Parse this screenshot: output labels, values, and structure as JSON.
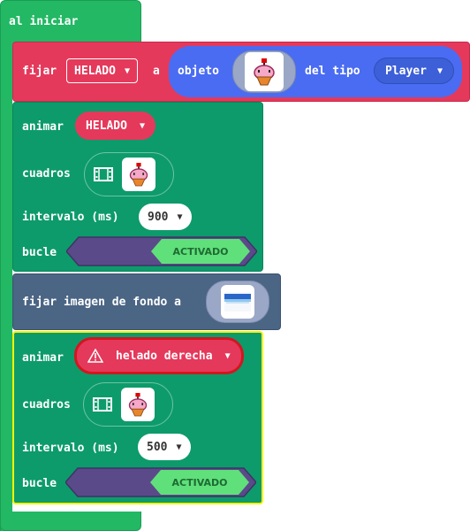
{
  "on_start": {
    "label": "al iniciar"
  },
  "set_sprite": {
    "set_label": "fijar",
    "variable": "HELADO",
    "to_label": "a",
    "sprite_label": "objeto",
    "kind_label": "del tipo",
    "kind_value": "Player"
  },
  "animate_1": {
    "animate_label": "animar",
    "target": "HELADO",
    "frames_label": "cuadros",
    "interval_label": "intervalo (ms)",
    "interval_value": "900",
    "loop_label": "bucle",
    "loop_state": "ACTIVADO"
  },
  "background": {
    "label": "fijar imagen de fondo a"
  },
  "animate_2": {
    "animate_label": "animar",
    "target": "helado derecha",
    "frames_label": "cuadros",
    "interval_label": "intervalo (ms)",
    "interval_value": "500",
    "loop_label": "bucle",
    "loop_state": "ACTIVADO"
  },
  "colors": {
    "event_green": "#22b864",
    "sprite_red": "#e5395b",
    "animation_green": "#0d9b6b",
    "scene_slate": "#4b6584",
    "sprite_kind_blue": "#4a6cf2",
    "toggle_purple": "#5b4a8a",
    "toggle_on": "#5fe07a",
    "selection_yellow": "#fff200"
  },
  "icons": [
    "caret-down-icon",
    "film-icon",
    "warning-icon",
    "ice-cream-sprite-icon",
    "background-image-icon"
  ]
}
